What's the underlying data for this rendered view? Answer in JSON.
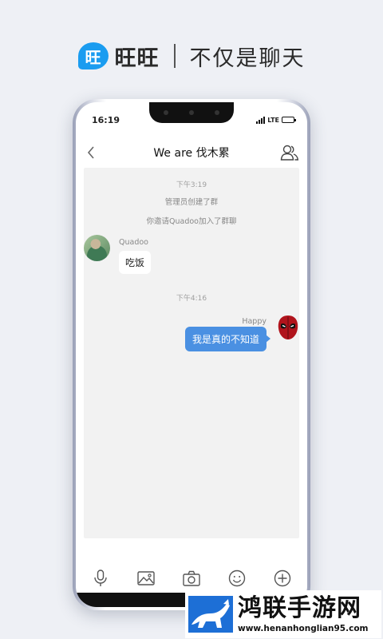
{
  "banner": {
    "badge": "旺",
    "brand": "旺旺",
    "slogan": "不仅是聊天",
    "brand_color": "#1a9cf0"
  },
  "status_bar": {
    "time": "16:19",
    "network": "LTE",
    "signal_bars": 4,
    "battery_level": 0.7
  },
  "nav": {
    "back_icon": "chevron-left-icon",
    "title": "We are 伐木累",
    "members_icon": "group-members-icon"
  },
  "chat": {
    "timestamp_1": "下午3:19",
    "system_1": "管理员创建了群",
    "system_2": "你邀请Quadoo加入了群聊",
    "message_1": {
      "sender": "Quadoo",
      "text": "吃饭"
    },
    "timestamp_2": "下午4:16",
    "message_2": {
      "sender": "Happy",
      "text": "我是真的不知道"
    },
    "bubble_color": "#4a90e2"
  },
  "toolbar": {
    "items": [
      "microphone-icon",
      "image-icon",
      "camera-icon",
      "emoji-icon",
      "plus-icon"
    ]
  },
  "watermark": {
    "title": "鸿联手游网",
    "url": "www.henanhonglian95.com"
  }
}
